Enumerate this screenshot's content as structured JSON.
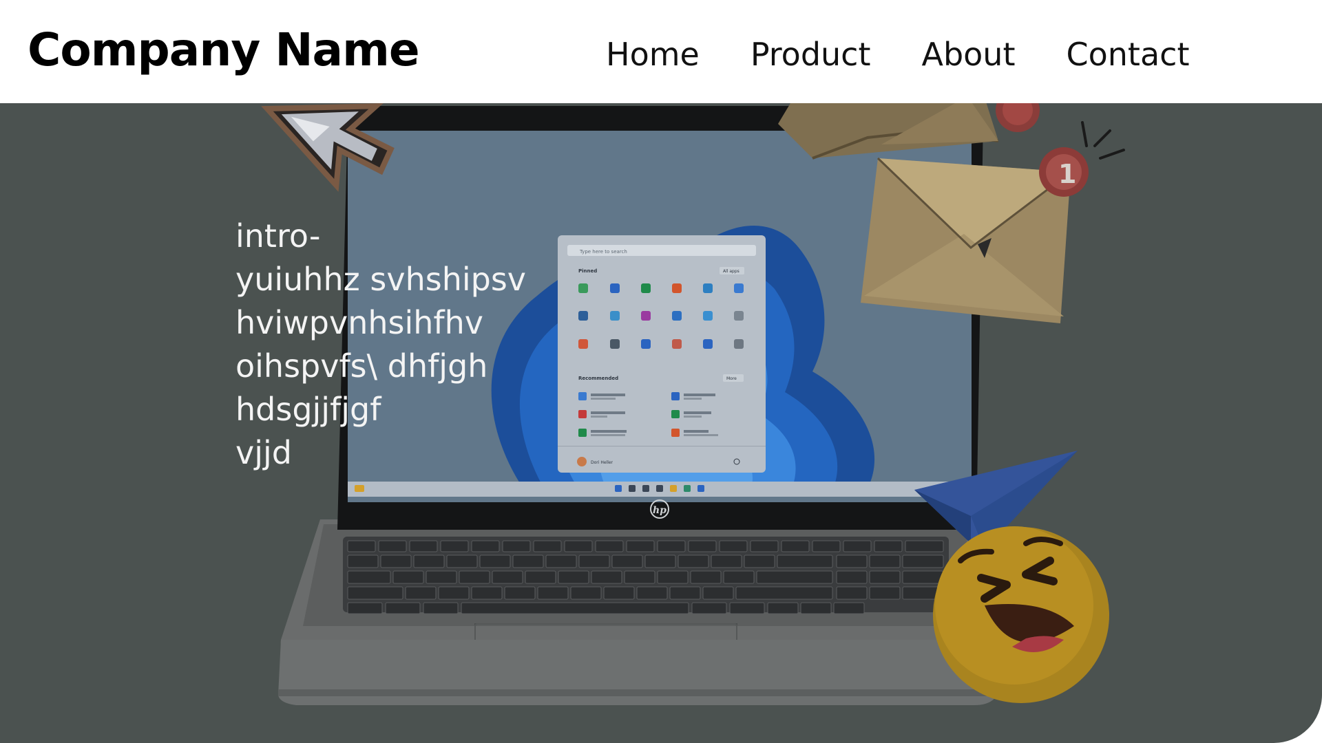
{
  "brand": {
    "name": "Company Name"
  },
  "nav": {
    "items": [
      {
        "label": "Home"
      },
      {
        "label": "Product"
      },
      {
        "label": "About"
      },
      {
        "label": "Contact"
      }
    ]
  },
  "hero": {
    "intro_text": "intro-\nyuiuhhz  svhshipsv\nhviwpvnhsihfhv\noihspvfs\\ dhfjgh\nhdsgjjfjgf\nvjjd",
    "laptop_brand": "hp",
    "notification_badge": "1",
    "start_menu": {
      "search_placeholder": "Type here to search",
      "pinned_label": "Pinned",
      "all_apps_label": "All apps",
      "recommended_label": "Recommended",
      "more_label": "More",
      "user_name": "Dori Heller"
    }
  },
  "colors": {
    "hero_background": "#4b5250",
    "header_background": "#ffffff",
    "text_on_hero": "#f4f4f4"
  },
  "icons": [
    "cursor-arrow-icon",
    "envelope-icon",
    "notification-badge-icon",
    "paper-plane-icon",
    "laughing-emoji-icon"
  ]
}
